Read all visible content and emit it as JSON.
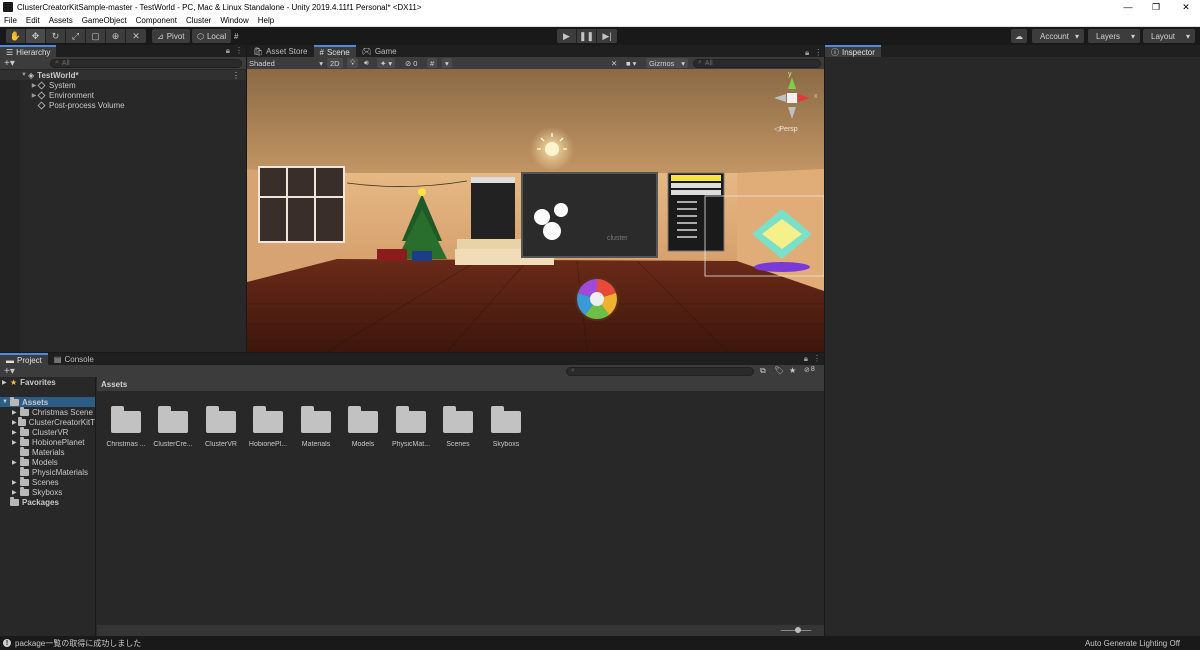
{
  "window": {
    "title": "ClusterCreatorKitSample-master - TestWorld - PC, Mac & Linux Standalone - Unity 2019.4.11f1 Personal* <DX11>",
    "minimize": "—",
    "maximize": "❐",
    "close": "✕"
  },
  "menu": [
    "File",
    "Edit",
    "Assets",
    "GameObject",
    "Component",
    "Cluster",
    "Window",
    "Help"
  ],
  "toolbar": {
    "pivot_label": "Pivot",
    "local_label": "Local",
    "account_label": "Account",
    "layers_label": "Layers",
    "layout_label": "Layout"
  },
  "hierarchy": {
    "tab_label": "Hierarchy",
    "search_placeholder": "All",
    "scene_name": "TestWorld*",
    "items": [
      "System",
      "Environment",
      "Post-process Volume"
    ]
  },
  "scene_tabs": [
    "Asset Store",
    "Scene",
    "Game"
  ],
  "scene_toolbar": {
    "shading_mode": "Shaded",
    "mode_2d": "2D",
    "hidden_count": "0",
    "gizmos_label": "Gizmos",
    "search_placeholder": "All"
  },
  "gizmo": {
    "axis_y": "y",
    "axis_x": "x",
    "projection": "Persp"
  },
  "viewport": {
    "screen_logo": "cluster"
  },
  "inspector": {
    "tab_label": "Inspector"
  },
  "project": {
    "tabs": [
      "Project",
      "Console"
    ],
    "favorites_label": "Favorites",
    "assets_label": "Assets",
    "packages_label": "Packages",
    "hidden_count": "8",
    "tree_folders": [
      "Christmas Scene",
      "ClusterCreatorKitT",
      "ClusterVR",
      "HobionePlanet",
      "Materials",
      "Models",
      "PhysicMaterials",
      "Scenes",
      "Skyboxs"
    ],
    "breadcrumb": "Assets",
    "grid_items": [
      "Christmas ...",
      "ClusterCre...",
      "ClusterVR",
      "HobionePl...",
      "Materials",
      "Models",
      "PhysicMat...",
      "Scenes",
      "Skyboxs"
    ]
  },
  "status": {
    "message": "package一覧の取得に成功しました",
    "right_text": "Auto Generate Lighting Off"
  },
  "colors": {
    "accent": "#4a8be8",
    "selection": "#2c5d87",
    "panel": "#282828",
    "dark": "#191919"
  }
}
